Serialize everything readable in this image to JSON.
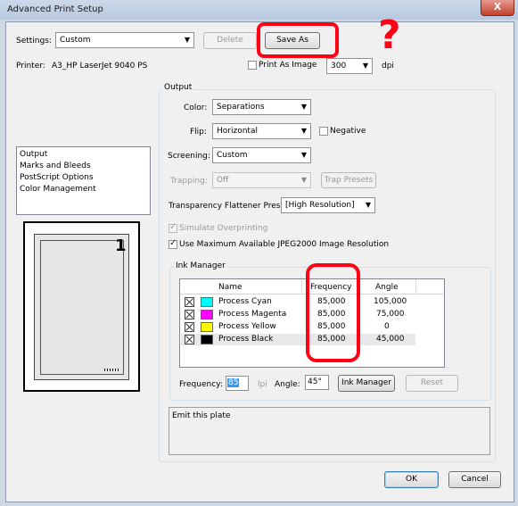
{
  "window": {
    "title": "Advanced Print Setup",
    "close_glyph": "X"
  },
  "settings": {
    "label": "Settings:",
    "value": "Custom",
    "delete_label": "Delete",
    "saveas_label": "Save As"
  },
  "printer": {
    "label": "Printer:",
    "value": "A3_HP LaserJet 9040 PS",
    "print_as_image_label": "Print As Image",
    "dpi_value": "300",
    "dpi_unit": "dpi"
  },
  "sidebar": {
    "items": [
      {
        "label": "Output"
      },
      {
        "label": "Marks and Bleeds"
      },
      {
        "label": "PostScript Options"
      },
      {
        "label": "Color Management"
      }
    ]
  },
  "preview": {
    "page_number": "1"
  },
  "output": {
    "group_label": "Output",
    "color_label": "Color:",
    "color_value": "Separations",
    "flip_label": "Flip:",
    "flip_value": "Horizontal",
    "negative_label": "Negative",
    "screening_label": "Screening:",
    "screening_value": "Custom",
    "trapping_label": "Trapping:",
    "trapping_value": "Off",
    "trap_presets_label": "Trap Presets",
    "flattener_label": "Transparency Flattener Preset:",
    "flattener_value": "[High Resolution]",
    "simulate_label": "Simulate Overprinting",
    "jpeg2000_label": "Use Maximum Available JPEG2000 Image Resolution"
  },
  "ink_manager": {
    "group_label": "Ink Manager",
    "columns": [
      "Name",
      "Frequency",
      "Angle"
    ],
    "rows": [
      {
        "name": "Process Cyan",
        "frequency": "85,000",
        "angle": "105,000",
        "color": "#00ffff"
      },
      {
        "name": "Process Magenta",
        "frequency": "85,000",
        "angle": "75,000",
        "color": "#ff00ff"
      },
      {
        "name": "Process Yellow",
        "frequency": "85,000",
        "angle": "0",
        "color": "#ffff00"
      },
      {
        "name": "Process Black",
        "frequency": "85,000",
        "angle": "45,000",
        "color": "#000000"
      }
    ],
    "frequency_label": "Frequency:",
    "frequency_value": "85",
    "frequency_unit": "lpi",
    "angle_label": "Angle:",
    "angle_value": "45°",
    "ink_manager_button": "Ink Manager",
    "reset_button": "Reset"
  },
  "description": {
    "text": "Emit this plate"
  },
  "footer": {
    "ok_label": "OK",
    "cancel_label": "Cancel"
  },
  "annotation": {
    "question_mark": "?",
    "color": "#ff0014"
  },
  "colors": {
    "accent_selection": "#cde8ff",
    "annotation_red": "#ff0014"
  }
}
